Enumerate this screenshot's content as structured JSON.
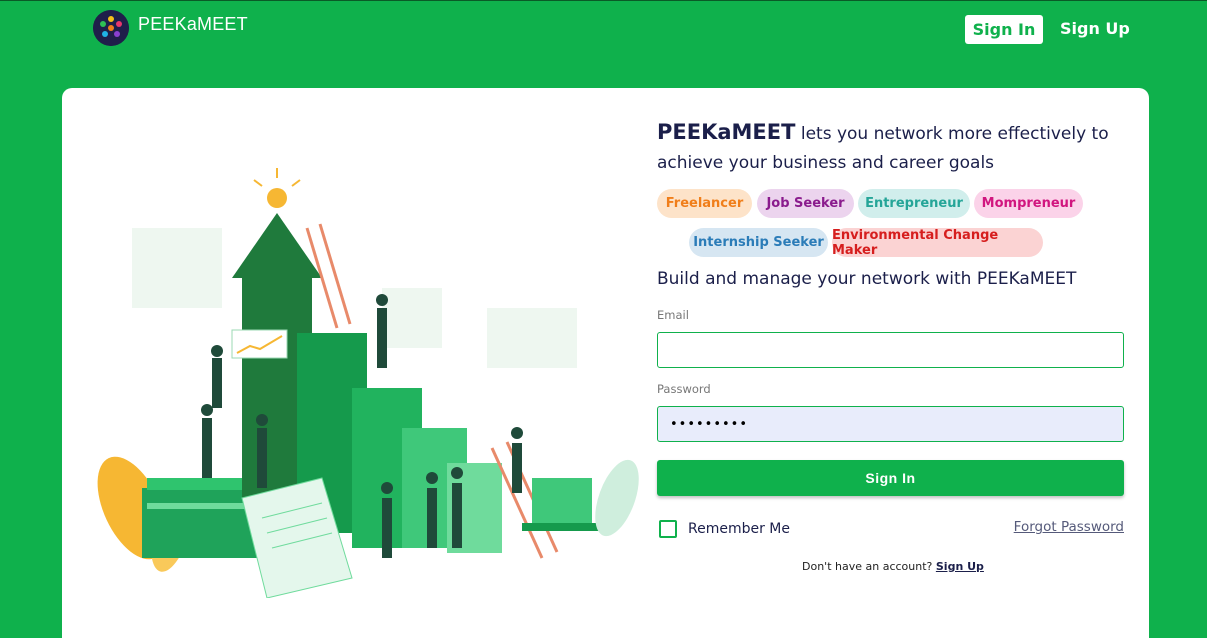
{
  "header": {
    "brand": "PEEKaMEET",
    "signin_label": "Sign In",
    "signup_label": "Sign Up"
  },
  "hero": {
    "brand": "PEEKaMEET",
    "tagline": "lets you network more effectively to achieve your business and career goals",
    "chips": [
      {
        "label": "Freelancer",
        "bg": "#fde3c9",
        "fg": "#f07e1a"
      },
      {
        "label": "Job Seeker",
        "bg": "#ecd4ee",
        "fg": "#8a1b8d"
      },
      {
        "label": "Entrepreneur",
        "bg": "#d1eeec",
        "fg": "#25a598"
      },
      {
        "label": "Mompreneur",
        "bg": "#fbd3e9",
        "fg": "#d1167f"
      },
      {
        "label": "Internship Seeker",
        "bg": "#d6e6f2",
        "fg": "#2b7cb8"
      },
      {
        "label": "Environmental Change Maker",
        "bg": "#fbd3d3",
        "fg": "#d61e1e"
      }
    ],
    "subheading": "Build and manage your network with PEEKaMEET"
  },
  "form": {
    "email_label": "Email",
    "email_value": "",
    "password_label": "Password",
    "password_value": "•••••••••",
    "submit_label": "Sign In",
    "remember_label": "Remember Me",
    "forgot_label": "Forgot Password",
    "no_account_text": "Don't have an account?",
    "signup_link": "Sign Up"
  },
  "colors": {
    "brand_green": "#0fb14c",
    "text_navy": "#1b1f4a"
  }
}
